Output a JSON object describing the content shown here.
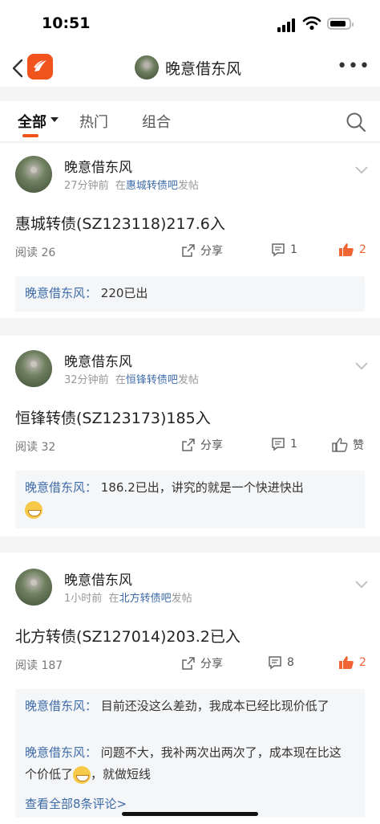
{
  "status": {
    "time": "10:51"
  },
  "header": {
    "title": "晚意借东风"
  },
  "tabs": [
    {
      "label": "全部",
      "active": true
    },
    {
      "label": "热门",
      "active": false
    },
    {
      "label": "组合",
      "active": false
    }
  ],
  "posts": [
    {
      "author": "晚意借东风",
      "time": "27分钟前",
      "prefix": "在",
      "bar": "惠城转债吧",
      "suffix": "发帖",
      "title": "惠城转债(SZ123118)217.6入",
      "reads": "阅读 26",
      "share": "分享",
      "comments": "1",
      "likes": "2",
      "liked": true,
      "replies": [
        {
          "name": "晚意借东风：",
          "text": "220已出"
        }
      ]
    },
    {
      "author": "晚意借东风",
      "time": "32分钟前",
      "prefix": "在",
      "bar": "恒锋转债吧",
      "suffix": "发帖",
      "title": "恒锋转债(SZ123173)185入",
      "reads": "阅读 32",
      "share": "分享",
      "comments": "1",
      "likes": "赞",
      "liked": false,
      "replies": [
        {
          "name": "晚意借东风：",
          "text": "186.2已出，讲究的就是一个快进快出"
        }
      ]
    },
    {
      "author": "晚意借东风",
      "time": "1小时前",
      "prefix": "在",
      "bar": "北方转债吧",
      "suffix": "发帖",
      "title": "北方转债(SZ127014)203.2已入",
      "reads": "阅读 187",
      "share": "分享",
      "comments": "8",
      "likes": "2",
      "liked": true,
      "replies": [
        {
          "name": "晚意借东风：",
          "text": "目前还没这么差劲，我成本已经比现价低了"
        },
        {
          "name": "晚意借东风：",
          "text": "问题不大，我补两次出两次了，成本现在比这个价低了",
          "text_after": "，就做短线"
        }
      ],
      "view_all": "查看全部8条评论>"
    }
  ],
  "colors": {
    "accent": "#f0531c",
    "link": "#3c6aa8",
    "like": "#ef6432"
  }
}
